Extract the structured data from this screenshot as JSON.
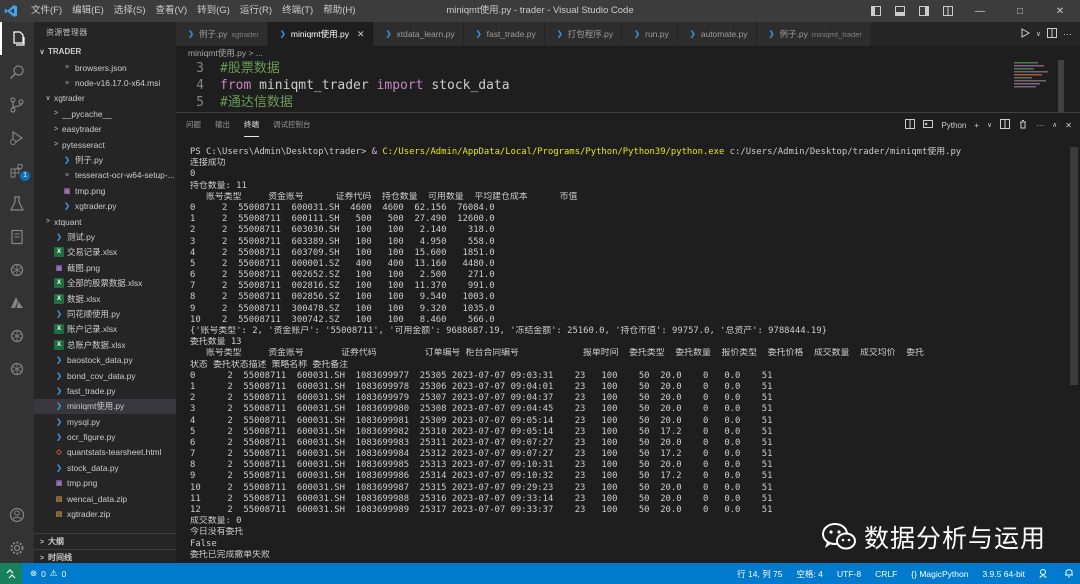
{
  "window": {
    "title": "miniqmt使用.py - trader - Visual Studio Code",
    "menu": [
      "文件(F)",
      "编辑(E)",
      "选择(S)",
      "查看(V)",
      "转到(G)",
      "运行(R)",
      "终端(T)",
      "帮助(H)"
    ]
  },
  "activity": {
    "source_control_badge": "1"
  },
  "sidebar": {
    "header": "资源管理器",
    "workspace": "TRADER",
    "items": [
      {
        "label": "browsers.json",
        "indent": 2,
        "type": "gen",
        "twistie": ""
      },
      {
        "label": "node-v16.17.0-x64.msi",
        "indent": 2,
        "type": "gen",
        "twistie": ""
      },
      {
        "label": "xgtrader",
        "indent": 1,
        "type": "folder",
        "twistie": "∨"
      },
      {
        "label": "__pycache__",
        "indent": 2,
        "type": "folder",
        "twistie": ">"
      },
      {
        "label": "easytrader",
        "indent": 2,
        "type": "folder",
        "twistie": ">"
      },
      {
        "label": "pytesseract",
        "indent": 2,
        "type": "folder",
        "twistie": ">"
      },
      {
        "label": "例子.py",
        "indent": 2,
        "type": "py",
        "twistie": ""
      },
      {
        "label": "tesseract-ocr-w64-setup-...",
        "indent": 2,
        "type": "gen",
        "twistie": ""
      },
      {
        "label": "tmp.png",
        "indent": 2,
        "type": "img",
        "twistie": ""
      },
      {
        "label": "xgtrader.py",
        "indent": 2,
        "type": "py",
        "twistie": ""
      },
      {
        "label": "xtquant",
        "indent": 1,
        "type": "folder",
        "twistie": ">"
      },
      {
        "label": "测试.py",
        "indent": 1,
        "type": "py",
        "twistie": ""
      },
      {
        "label": "交易记录.xlsx",
        "indent": 1,
        "type": "xl",
        "twistie": ""
      },
      {
        "label": "截图.png",
        "indent": 1,
        "type": "img",
        "twistie": ""
      },
      {
        "label": "全部的股票数据.xlsx",
        "indent": 1,
        "type": "xl",
        "twistie": ""
      },
      {
        "label": "数据.xlsx",
        "indent": 1,
        "type": "xl",
        "twistie": ""
      },
      {
        "label": "同花顺使用.py",
        "indent": 1,
        "type": "py",
        "twistie": ""
      },
      {
        "label": "账户记录.xlsx",
        "indent": 1,
        "type": "xl",
        "twistie": ""
      },
      {
        "label": "总账户数据.xlsx",
        "indent": 1,
        "type": "xl",
        "twistie": ""
      },
      {
        "label": "baostock_data.py",
        "indent": 1,
        "type": "py",
        "twistie": ""
      },
      {
        "label": "bond_cov_data.py",
        "indent": 1,
        "type": "py",
        "twistie": ""
      },
      {
        "label": "fast_trade.py",
        "indent": 1,
        "type": "py",
        "twistie": ""
      },
      {
        "label": "miniqmt使用.py",
        "indent": 1,
        "type": "py",
        "twistie": "",
        "selected": true
      },
      {
        "label": "mysql.py",
        "indent": 1,
        "type": "py",
        "twistie": ""
      },
      {
        "label": "ocr_figure.py",
        "indent": 1,
        "type": "py",
        "twistie": ""
      },
      {
        "label": "quantstats-tearsheet.html",
        "indent": 1,
        "type": "html",
        "twistie": ""
      },
      {
        "label": "stock_data.py",
        "indent": 1,
        "type": "py",
        "twistie": ""
      },
      {
        "label": "tmp.png",
        "indent": 1,
        "type": "img",
        "twistie": ""
      },
      {
        "label": "wencai_data.zip",
        "indent": 1,
        "type": "zip",
        "twistie": ""
      },
      {
        "label": "xgtrader.zip",
        "indent": 1,
        "type": "zip",
        "twistie": ""
      }
    ],
    "outline": "大纲",
    "timeline": "时间线"
  },
  "tabs": [
    {
      "label": "例子.py",
      "hint": "xgtrader",
      "active": false
    },
    {
      "label": "miniqmt使用.py",
      "hint": "",
      "active": true
    },
    {
      "label": "xtdata_learn.py",
      "hint": "",
      "active": false
    },
    {
      "label": "fast_trade.py",
      "hint": "",
      "active": false
    },
    {
      "label": "打包程序.py",
      "hint": "",
      "active": false
    },
    {
      "label": "run.py",
      "hint": "",
      "active": false
    },
    {
      "label": "automate.py",
      "hint": "",
      "active": false
    },
    {
      "label": "例子.py",
      "hint": "miniqmt_trader",
      "active": false
    }
  ],
  "breadcrumb": "miniqmt使用.py > ...",
  "editor": {
    "lines": [
      {
        "num": "3",
        "parts": [
          {
            "t": "#股票数据",
            "c": "cm"
          }
        ]
      },
      {
        "num": "4",
        "parts": [
          {
            "t": "from ",
            "c": "kw"
          },
          {
            "t": "miniqmt_trader ",
            "c": "mod"
          },
          {
            "t": "import ",
            "c": "kw"
          },
          {
            "t": "stock_data",
            "c": "mod"
          }
        ]
      },
      {
        "num": "5",
        "parts": [
          {
            "t": "#通达信数据",
            "c": "cm"
          }
        ]
      }
    ]
  },
  "panel": {
    "tabs": [
      "问题",
      "输出",
      "终端",
      "调试控制台"
    ],
    "active_tab": "终端",
    "terminal_name": "Python",
    "terminal": {
      "prompt": "PS C:\\Users\\Admin\\Desktop\\trader> & ",
      "exe": "C:/Users/Admin/AppData/Local/Programs/Python/Python39/python.exe",
      "args": " c:/Users/Admin/Desktop/trader/miniqmt使用.py",
      "lines": [
        "连接成功",
        "0",
        "持仓数量: 11",
        "   账号类型     资金账号      证券代码  持仓数量  可用数量  平均建仓成本      市值",
        "0     2  55008711  600031.SH  4600  4600  62.156  76084.0",
        "1     2  55008711  600111.SH   500   500  27.490  12600.0",
        "2     2  55008711  603030.SH   100   100   2.140    318.0",
        "3     2  55008711  603389.SH   100   100   4.950    558.0",
        "4     2  55008711  603709.SH   100   100  15.600   1851.0",
        "5     2  55008711  000001.SZ   400   400  13.160   4480.0",
        "6     2  55008711  002652.SZ   100   100   2.500    271.0",
        "7     2  55008711  002816.SZ   100   100  11.370    991.0",
        "8     2  55008711  002856.SZ   100   100   9.540   1003.0",
        "9     2  55008711  300478.SZ   100   100   9.320   1035.0",
        "10    2  55008711  300742.SZ   100   100   8.460    566.0",
        "{'账号类型': 2, '资金账户': '55008711', '可用金额': 9688687.19, '冻结金额': 25160.0, '持仓市值': 99757.0, '总资产': 9788444.19}",
        "委托数量 13",
        "   账号类型     资金账号       证券代码         订单编号 柜台合同编号            报单时间  委托类型  委托数量  报价类型  委托价格  成交数量  成交均价  委托",
        "状态 委托状态描述 策略名称 委托备注",
        "0      2  55008711  600031.SH  1083699977  25305 2023-07-07 09:03:31    23   100    50  20.0    0   0.0    51",
        "1      2  55008711  600031.SH  1083699978  25306 2023-07-07 09:04:01    23   100    50  20.0    0   0.0    51",
        "2      2  55008711  600031.SH  1083699979  25307 2023-07-07 09:04:37    23   100    50  20.0    0   0.0    51",
        "3      2  55008711  600031.SH  1083699980  25308 2023-07-07 09:04:45    23   100    50  20.0    0   0.0    51",
        "4      2  55008711  600031.SH  1083699981  25309 2023-07-07 09:05:14    23   100    50  20.0    0   0.0    51",
        "5      2  55008711  600031.SH  1083699982  25310 2023-07-07 09:05:14    23   100    50  17.2    0   0.0    51",
        "6      2  55008711  600031.SH  1083699983  25311 2023-07-07 09:07:27    23   100    50  20.0    0   0.0    51",
        "7      2  55008711  600031.SH  1083699984  25312 2023-07-07 09:07:27    23   100    50  17.2    0   0.0    51",
        "8      2  55008711  600031.SH  1083699985  25313 2023-07-07 09:10:31    23   100    50  20.0    0   0.0    51",
        "9      2  55008711  600031.SH  1083699986  25314 2023-07-07 09:10:32    23   100    50  17.2    0   0.0    51",
        "10     2  55008711  600031.SH  1083699987  25315 2023-07-07 09:29:23    23   100    50  20.0    0   0.0    51",
        "11     2  55008711  600031.SH  1083699988  25316 2023-07-07 09:33:14    23   100    50  20.0    0   0.0    51",
        "12     2  55008711  600031.SH  1083699989  25317 2023-07-07 09:33:37    23   100    50  20.0    0   0.0    51",
        "成交数量: 0",
        "今日没有委托",
        "False",
        "委托已完成撤单失败"
      ]
    }
  },
  "watermark": "数据分析与运用",
  "statusbar": {
    "errors": "0",
    "warnings": "0",
    "position": "行 14, 列 75",
    "spaces": "空格: 4",
    "encoding": "UTF-8",
    "eol": "CRLF",
    "language": "MagicPython",
    "interpreter": "3.9.5 64-bit"
  },
  "colors": {
    "accent": "#007acc",
    "terminal_bg": "#1e1e1e",
    "path_yellow": "#e5e510"
  }
}
